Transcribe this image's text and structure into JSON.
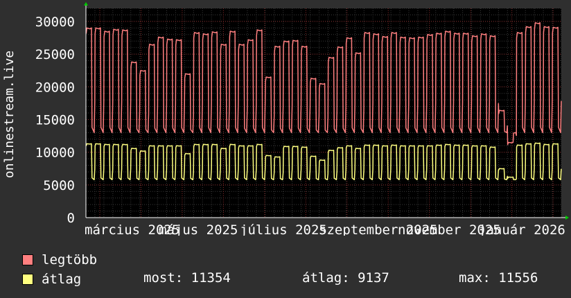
{
  "chart_data": {
    "type": "line",
    "ylabel": "onlinestream.live",
    "ylim": [
      0,
      32000
    ],
    "yticks": [
      0,
      5000,
      10000,
      15000,
      20000,
      25000,
      30000
    ],
    "x_tick_labels": [
      "március 2025",
      "május 2025",
      "július 2025",
      "szeptember 2025",
      "november 2025",
      "január 2026"
    ],
    "grid": true,
    "colors": {
      "background": "#000000",
      "grid": "#3a3a3a",
      "minor_grid": "#8b2b2b",
      "axis": "#ffffff",
      "arrow": "#00cc00"
    },
    "series": [
      {
        "name": "legtöbb",
        "color": "#ff7f7f",
        "weekday_peak": [
          29000,
          29000,
          28500,
          28800,
          28700,
          23800,
          22500,
          26500,
          27600,
          27300,
          27200,
          22000,
          28300,
          28100,
          28400,
          26500,
          28500,
          26500,
          27200,
          28700,
          21500,
          26200,
          27000,
          27100,
          26200,
          21300,
          20500,
          24500,
          26100,
          27500,
          25200,
          28300,
          28100,
          27700,
          28300,
          27600,
          27500,
          27600,
          28000,
          28200,
          28500,
          28200,
          28200,
          27800,
          28100,
          27800,
          16400,
          11500,
          28300,
          29200,
          29800,
          29200,
          29100
        ]
      },
      {
        "name": "átlag",
        "color": "#ffff80",
        "weekday_peak": [
          11300,
          11300,
          11200,
          11200,
          11200,
          10600,
          10200,
          11000,
          11000,
          11000,
          11000,
          9800,
          11200,
          11200,
          11200,
          10600,
          11200,
          11000,
          11000,
          11200,
          9500,
          9300,
          10900,
          10900,
          10800,
          9400,
          8800,
          10300,
          10700,
          11000,
          10600,
          11100,
          11100,
          11000,
          11100,
          11000,
          11000,
          11000,
          11000,
          11100,
          11200,
          11100,
          11100,
          11000,
          11000,
          10800,
          7500,
          6200,
          11100,
          11300,
          11400,
          11200,
          11300
        ],
        "most": 11354,
        "atlag": 9137,
        "max": 11556
      }
    ],
    "weekend_low_legtobb": 13000,
    "weekend_low_atlag": 5800
  },
  "legend": {
    "items": [
      {
        "label": "legtöbb",
        "color": "#ff7f7f"
      },
      {
        "label": "átlag",
        "color": "#ffff80"
      }
    ],
    "stats": {
      "most": "most: 11354",
      "atlag": "átlag: 9137",
      "max": "max: 11556"
    }
  }
}
